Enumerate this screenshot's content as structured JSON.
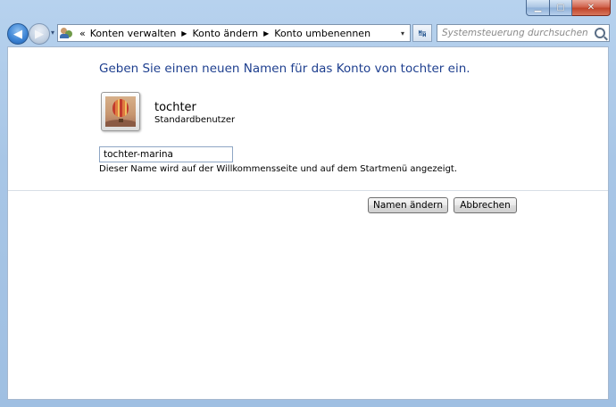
{
  "window": {
    "caption": {
      "minimize_glyph": "▁",
      "maximize_glyph": "▢",
      "close_glyph": "✕"
    }
  },
  "nav": {
    "back_glyph": "◀",
    "forward_glyph": "▶",
    "history_glyph": "▾",
    "breadcrumbs": [
      "Konten verwalten",
      "Konto ändern",
      "Konto umbenennen"
    ],
    "overflow_glyph": "«",
    "separator_glyph": "▶",
    "dropdown_glyph": "▾",
    "refresh_glyph": "↹",
    "search_placeholder": "Systemsteuerung durchsuchen"
  },
  "page": {
    "heading": "Geben Sie einen neuen Namen für das Konto von tochter ein.",
    "user": {
      "name": "tochter",
      "role": "Standardbenutzer"
    },
    "name_input_value": "tochter-marina",
    "hint": "Dieser Name wird auf der Willkommensseite und auf dem Startmenü angezeigt.",
    "buttons": {
      "rename": "Namen ändern",
      "cancel": "Abbrechen"
    }
  },
  "colors": {
    "heading": "#1e3f8f",
    "frame": "#a8c6e6",
    "close_button": "#c0442a"
  },
  "icons": {
    "address_bar": "user-accounts-icon",
    "avatar": "hot-air-balloon-picture",
    "search": "search-icon"
  }
}
